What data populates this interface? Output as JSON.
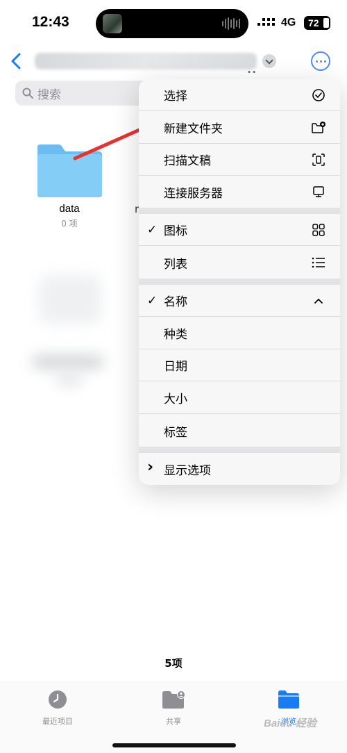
{
  "status_bar": {
    "time": "12:43",
    "network": "4G",
    "battery": "72"
  },
  "search": {
    "placeholder": "搜索"
  },
  "folders": [
    {
      "name": "data",
      "count": "0 项"
    }
  ],
  "ghost_char": "r",
  "menu": {
    "items": [
      {
        "label": "选择",
        "icon": "checkmark-circle-icon",
        "checked": false
      },
      {
        "label": "新建文件夹",
        "icon": "folder-plus-icon",
        "checked": false
      },
      {
        "label": "扫描文稿",
        "icon": "doc-scan-icon",
        "checked": false
      },
      {
        "label": "连接服务器",
        "icon": "display-icon",
        "checked": false
      },
      {
        "label": "图标",
        "icon": "grid-icon",
        "checked": true
      },
      {
        "label": "列表",
        "icon": "list-icon",
        "checked": false
      },
      {
        "label": "名称",
        "icon": "chevron-up-icon",
        "checked": true
      },
      {
        "label": "种类",
        "checked": false
      },
      {
        "label": "日期",
        "checked": false
      },
      {
        "label": "大小",
        "checked": false
      },
      {
        "label": "标签",
        "checked": false
      },
      {
        "label": "显示选项",
        "checked": false
      }
    ],
    "check_glyph": "✓",
    "expand_glyph": "›"
  },
  "footer": {
    "count": "5项"
  },
  "tabs": [
    {
      "label": "最近项目",
      "icon": "clock-icon",
      "active": false
    },
    {
      "label": "共享",
      "icon": "shared-folder-icon",
      "active": false
    },
    {
      "label": "浏览",
      "icon": "folder-icon",
      "active": true
    }
  ],
  "watermark": "Baidu 经验",
  "colors": {
    "accent": "#1a7cf5",
    "folder": "#7cc6f4",
    "arrow": "#e8322e"
  }
}
